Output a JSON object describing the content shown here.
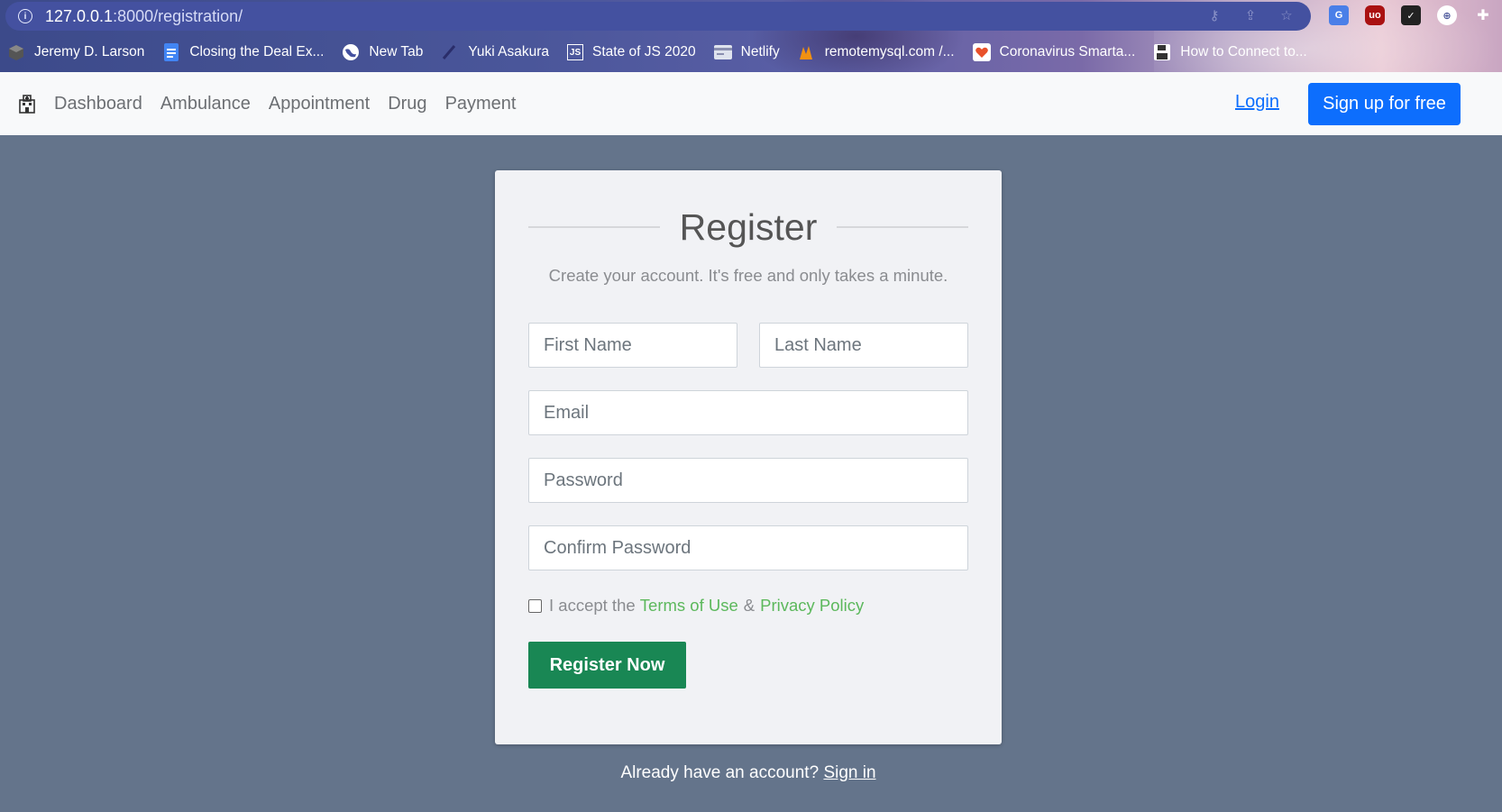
{
  "browser": {
    "url_host": "127.0.0.1",
    "url_path": ":8000/registration/",
    "bookmarks": [
      {
        "label": "Jeremy D. Larson",
        "icon": "cube-icon"
      },
      {
        "label": "Closing the Deal Ex...",
        "icon": "doc-icon"
      },
      {
        "label": "New Tab",
        "icon": "globe-icon"
      },
      {
        "label": "Yuki Asakura",
        "icon": "brush-icon"
      },
      {
        "label": "State of JS 2020",
        "icon": "js-icon"
      },
      {
        "label": "Netlify",
        "icon": "card-icon"
      },
      {
        "label": "remotemysql.com /...",
        "icon": "pma-icon"
      },
      {
        "label": "Coronavirus Smarta...",
        "icon": "heart-icon"
      },
      {
        "label": "How to Connect to...",
        "icon": "floppy-icon"
      }
    ]
  },
  "navbar": {
    "links": [
      "Dashboard",
      "Ambulance",
      "Appointment",
      "Drug",
      "Payment"
    ],
    "login": "Login",
    "signup": "Sign up for free"
  },
  "form": {
    "title": "Register",
    "subtitle": "Create your account. It's free and only takes a minute.",
    "first_name_placeholder": "First Name",
    "last_name_placeholder": "Last Name",
    "email_placeholder": "Email",
    "password_placeholder": "Password",
    "confirm_password_placeholder": "Confirm Password",
    "accept_prefix": "I accept the",
    "terms": "Terms of Use",
    "amp": "&",
    "privacy": "Privacy Policy",
    "submit": "Register Now"
  },
  "footer": {
    "prompt": "Already have an account?",
    "signin": "Sign in"
  },
  "colors": {
    "page_bg": "#64748b",
    "primary": "#0d6efd",
    "success": "#198754",
    "link_green": "#5cb85c"
  }
}
